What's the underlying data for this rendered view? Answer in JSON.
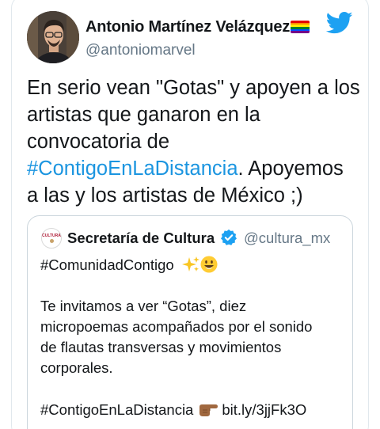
{
  "tweet": {
    "author_name": "Antonio Martínez Velázquez",
    "author_handle": "@antoniomarvel",
    "text_lines": [
      "En serio vean \"Gotas\" y apoyen a los",
      "artistas que ganaron en la",
      "convocatoria de"
    ],
    "hashtag": "#ContigoEnLaDistancia",
    "after_hashtag": ". Apoyemos",
    "last_line": "a las y los artistas de México ;)",
    "flag_colors": [
      "#e40303",
      "#ff8c00",
      "#ffed00",
      "#008026",
      "#004dff",
      "#750787"
    ],
    "brand_icon": "twitter-bird-icon"
  },
  "quote": {
    "avatar_logo_text": "CULTURA",
    "author_name": "Secretaría de Cultura",
    "verified_icon": "verified-badge-icon",
    "author_handle": "@cultura_mx",
    "hashtag_line": "#ComunidadContigo",
    "body_lines": [
      "Te invitamos a ver “Gotas”, diez",
      "micropoemas acompañados por el sonido",
      "de flautas transversas y movimientos",
      "corporales."
    ],
    "footer_hashtag": "#ContigoEnLaDistancia",
    "footer_link": "bit.ly/3jjFk3O",
    "emoji_icons": [
      "sparkles-icon",
      "smiling-face-icon",
      "pointing-right-icon"
    ]
  },
  "colors": {
    "link_blue": "#1b95e0",
    "twitter_blue": "#1da1f2",
    "secondary_text": "#657786"
  }
}
